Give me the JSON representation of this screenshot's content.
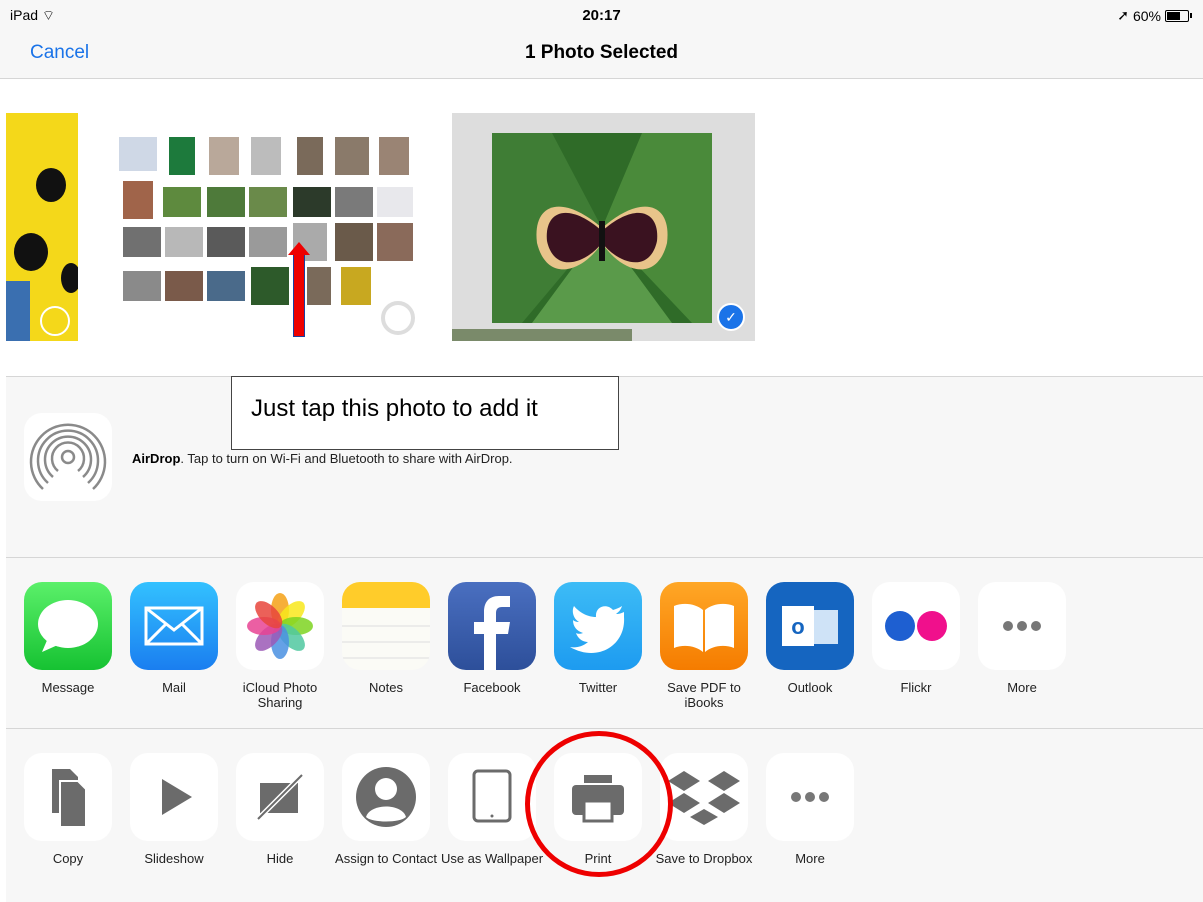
{
  "status_bar": {
    "device": "iPad",
    "time": "20:17",
    "battery": "60%"
  },
  "nav": {
    "cancel_label": "Cancel",
    "title": "1 Photo Selected"
  },
  "callout": {
    "text": "Just tap this photo to add it"
  },
  "airdrop": {
    "title": "AirDrop",
    "message": ". Tap to turn on Wi-Fi and Bluetooth to share with AirDrop."
  },
  "share_apps": [
    {
      "label": "Message"
    },
    {
      "label": "Mail"
    },
    {
      "label": "iCloud Photo Sharing"
    },
    {
      "label": "Notes"
    },
    {
      "label": "Facebook"
    },
    {
      "label": "Twitter"
    },
    {
      "label": "Save PDF to iBooks"
    },
    {
      "label": "Outlook"
    },
    {
      "label": "Flickr"
    },
    {
      "label": "More"
    }
  ],
  "actions": [
    {
      "label": "Copy"
    },
    {
      "label": "Slideshow"
    },
    {
      "label": "Hide"
    },
    {
      "label": "Assign to Contact"
    },
    {
      "label": "Use as Wallpaper"
    },
    {
      "label": "Print"
    },
    {
      "label": "Save to Dropbox"
    },
    {
      "label": "More"
    }
  ],
  "colors": {
    "accent": "#1a73e8",
    "annotation": "#e00000"
  }
}
